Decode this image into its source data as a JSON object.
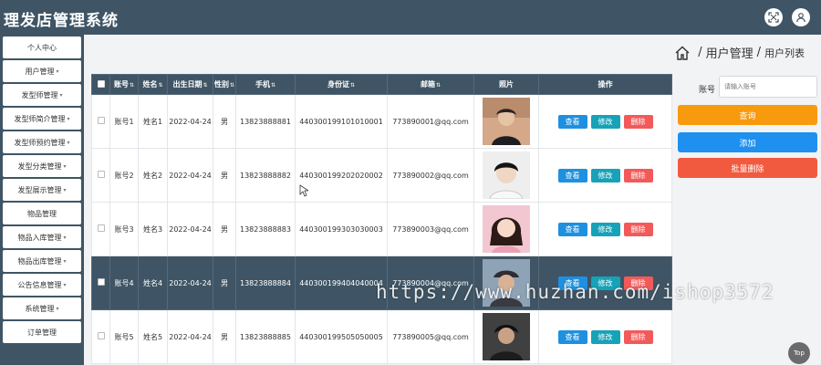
{
  "header": {
    "title": "理发店管理系统",
    "icons": [
      "fullscreen-icon",
      "user-icon"
    ]
  },
  "sidebar": {
    "items": [
      {
        "label": "个人中心",
        "has_chevron": false
      },
      {
        "label": "用户管理",
        "has_chevron": true
      },
      {
        "label": "发型师管理",
        "has_chevron": true
      },
      {
        "label": "发型师简介管理",
        "has_chevron": true
      },
      {
        "label": "发型师预约管理",
        "has_chevron": true
      },
      {
        "label": "发型分类管理",
        "has_chevron": true
      },
      {
        "label": "发型展示管理",
        "has_chevron": true
      },
      {
        "label": "物品管理",
        "has_chevron": false
      },
      {
        "label": "物品入库管理",
        "has_chevron": true
      },
      {
        "label": "物品出库管理",
        "has_chevron": true
      },
      {
        "label": "公告信息管理",
        "has_chevron": true
      },
      {
        "label": "系统管理",
        "has_chevron": true
      },
      {
        "label": "订单管理",
        "has_chevron": false
      }
    ]
  },
  "breadcrumb": {
    "home_icon": "home-icon",
    "separator": "/",
    "section": "用户管理",
    "page": "用户列表"
  },
  "table": {
    "columns": [
      "账号",
      "姓名",
      "出生日期",
      "性别",
      "手机",
      "身份证",
      "邮箱",
      "照片",
      "操作"
    ],
    "rows": [
      {
        "account": "账号1",
        "name": "姓名1",
        "birth": "2022-04-24",
        "gender": "男",
        "phone": "13823888881",
        "id_card": "440300199101010001",
        "email": "773890001@qq.com",
        "highlighted": false
      },
      {
        "account": "账号2",
        "name": "姓名2",
        "birth": "2022-04-24",
        "gender": "男",
        "phone": "13823888882",
        "id_card": "440300199202020002",
        "email": "773890002@qq.com",
        "highlighted": false
      },
      {
        "account": "账号3",
        "name": "姓名3",
        "birth": "2022-04-24",
        "gender": "男",
        "phone": "13823888883",
        "id_card": "440300199303030003",
        "email": "773890003@qq.com",
        "highlighted": false
      },
      {
        "account": "账号4",
        "name": "姓名4",
        "birth": "2022-04-24",
        "gender": "男",
        "phone": "13823888884",
        "id_card": "440300199404040004",
        "email": "773890004@qq.com",
        "highlighted": true
      },
      {
        "account": "账号5",
        "name": "姓名5",
        "birth": "2022-04-24",
        "gender": "男",
        "phone": "13823888885",
        "id_card": "440300199505050005",
        "email": "773890005@qq.com",
        "highlighted": false
      }
    ],
    "actions": {
      "view": "查看",
      "edit": "修改",
      "delete": "删除"
    }
  },
  "search": {
    "label": "账号",
    "placeholder": "请输入账号",
    "query_button": "查询",
    "add_button": "添加",
    "batch_delete_button": "批量删除"
  },
  "watermark": "https://www.huzhan.com/ishop3572",
  "back_to_top": "Top",
  "colors": {
    "header_bg": "#3f5565",
    "query": "#f79a0e",
    "add": "#1e90f0",
    "batch_delete": "#f25a3f",
    "view": "#1e90e0",
    "edit": "#17a2b8",
    "delete": "#f25a5a"
  }
}
